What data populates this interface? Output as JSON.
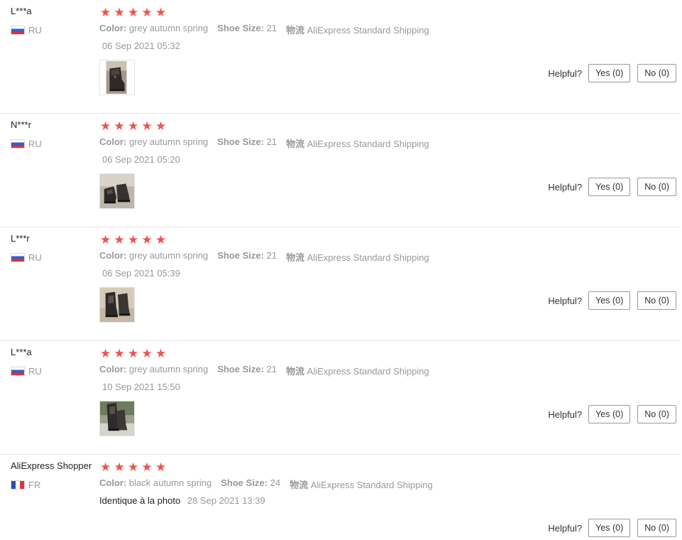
{
  "helpful_label": "Helpful?",
  "labels": {
    "color": "Color:",
    "shoe_size": "Shoe Size:",
    "shipping": "物流"
  },
  "reviews": [
    {
      "user": "L***a",
      "country": "RU",
      "rating": 5,
      "color": "grey autumn spring",
      "shoe_size": "21",
      "shipping": "AliExpress Standard Shipping",
      "text": "",
      "date": "06 Sep 2021 05:32",
      "has_photo": true,
      "yes": "Yes (0)",
      "no": "No (0)"
    },
    {
      "user": "N***r",
      "country": "RU",
      "rating": 5,
      "color": "grey autumn spring",
      "shoe_size": "21",
      "shipping": "AliExpress Standard Shipping",
      "text": "",
      "date": "06 Sep 2021 05:20",
      "has_photo": true,
      "yes": "Yes (0)",
      "no": "No (0)"
    },
    {
      "user": "L***r",
      "country": "RU",
      "rating": 5,
      "color": "grey autumn spring",
      "shoe_size": "21",
      "shipping": "AliExpress Standard Shipping",
      "text": "",
      "date": "06 Sep 2021 05:39",
      "has_photo": true,
      "yes": "Yes (0)",
      "no": "No (0)"
    },
    {
      "user": "L***a",
      "country": "RU",
      "rating": 5,
      "color": "grey autumn spring",
      "shoe_size": "21",
      "shipping": "AliExpress Standard Shipping",
      "text": "",
      "date": "10 Sep 2021 15:50",
      "has_photo": true,
      "yes": "Yes (0)",
      "no": "No (0)"
    },
    {
      "user": "AliExpress Shopper",
      "country": "FR",
      "rating": 5,
      "color": "black autumn spring",
      "shoe_size": "24",
      "shipping": "AliExpress Standard Shipping",
      "text": "Identique à la photo",
      "date": "28 Sep 2021 13:39",
      "has_photo": false,
      "yes": "Yes (0)",
      "no": "No (0)"
    }
  ],
  "colors": {
    "star": "#f0524b",
    "muted_text": "#999999",
    "divider": "#e8e8e8"
  }
}
